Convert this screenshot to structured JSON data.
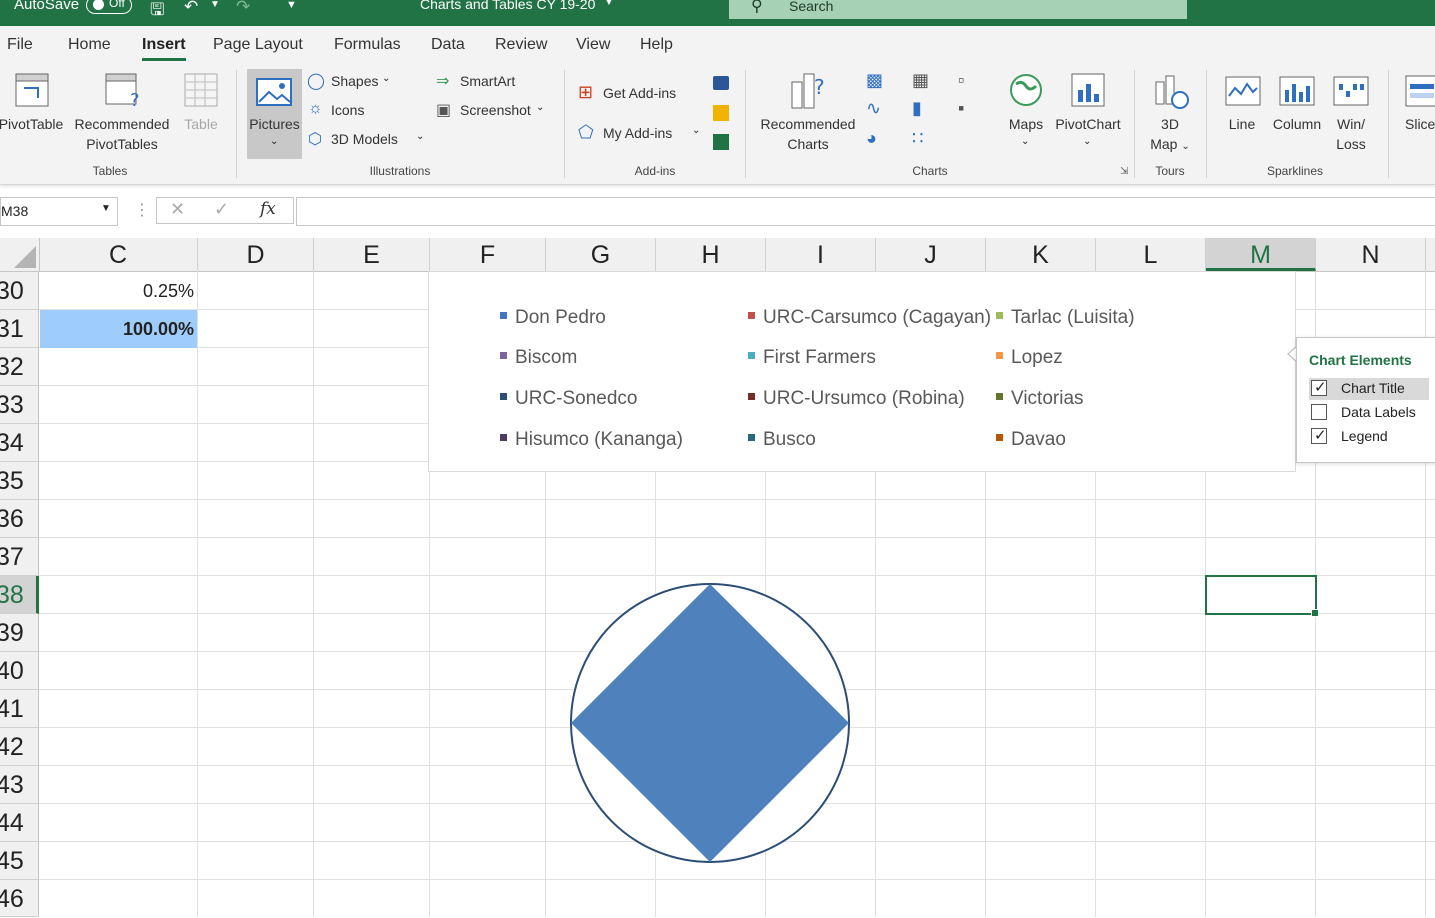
{
  "titlebar": {
    "autosave_label": "AutoSave",
    "autosave_state": "Off",
    "document_title": "Charts and Tables CY 19-20",
    "search_placeholder": "Search"
  },
  "menu": {
    "items": [
      "File",
      "Home",
      "Insert",
      "Page Layout",
      "Formulas",
      "Data",
      "Review",
      "View",
      "Help"
    ],
    "active": "Insert"
  },
  "ribbon": {
    "tables": {
      "group": "Tables",
      "pivottable": "PivotTable",
      "recommended_pivottables_1": "Recommended",
      "recommended_pivottables_2": "PivotTables",
      "table": "Table"
    },
    "illustrations": {
      "group": "Illustrations",
      "pictures": "Pictures",
      "shapes": "Shapes",
      "icons": "Icons",
      "models3d": "3D Models",
      "smartart": "SmartArt",
      "screenshot": "Screenshot"
    },
    "addins": {
      "group": "Add-ins",
      "get_addins": "Get Add-ins",
      "my_addins": "My Add-ins"
    },
    "charts": {
      "group": "Charts",
      "recommended_1": "Recommended",
      "recommended_2": "Charts",
      "maps": "Maps",
      "pivotchart": "PivotChart"
    },
    "tours": {
      "group": "Tours",
      "map3d_1": "3D",
      "map3d_2": "Map"
    },
    "sparklines": {
      "group": "Sparklines",
      "line": "Line",
      "column": "Column",
      "winloss_1": "Win/",
      "winloss_2": "Loss"
    },
    "filters": {
      "slicer": "Slice"
    }
  },
  "formula_bar": {
    "name_box": "M38",
    "fx": "fx",
    "content": ""
  },
  "grid": {
    "columns": [
      "C",
      "D",
      "E",
      "F",
      "G",
      "H",
      "I",
      "J",
      "K",
      "L",
      "M",
      "N"
    ],
    "selected_column": "M",
    "rows": [
      "30",
      "31",
      "32",
      "33",
      "34",
      "35",
      "36",
      "37",
      "38",
      "39",
      "40",
      "41",
      "42",
      "43",
      "44",
      "45",
      "46"
    ],
    "selected_row": "38",
    "cells": {
      "C30": "0.25%",
      "C31": "100.00%"
    }
  },
  "chart_data": {
    "type": "pie",
    "categories": [
      "Don Pedro",
      "URC-Carsumco (Cagayan)",
      "Tarlac (Luisita)",
      "Biscom",
      "First Farmers",
      "Lopez",
      "URC-Sonedco",
      "URC-Ursumco (Robina)",
      "Victorias",
      "Hisumco (Kananga)",
      "Busco",
      "Davao"
    ],
    "colors": [
      "#4472C4",
      "#C0504D",
      "#9BBB59",
      "#8064A2",
      "#4BACC6",
      "#F79646",
      "#2C4D75",
      "#772C2A",
      "#5F7530",
      "#4D3B62",
      "#276A7C",
      "#B65708"
    ],
    "title": "",
    "legend": "top",
    "shape_fill": "#4F81BD",
    "shape_outline": "#2C4D75"
  },
  "chart_elements": {
    "title": "Chart Elements",
    "items": [
      {
        "label": "Chart Title",
        "checked": true
      },
      {
        "label": "Data Labels",
        "checked": false
      },
      {
        "label": "Legend",
        "checked": true
      }
    ]
  }
}
